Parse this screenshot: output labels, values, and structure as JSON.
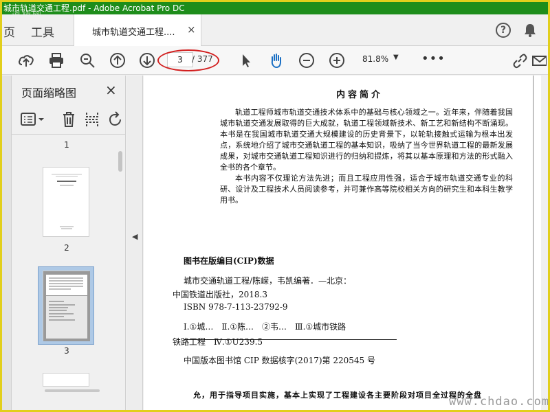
{
  "window": {
    "title": "城市轨道交通工程.pdf - Adobe Acrobat Pro DC",
    "watermark_top": "道桥网"
  },
  "menu": {
    "page": "页",
    "tools": "工具"
  },
  "tab": {
    "label": "城市轨道交通工程....",
    "close": "×"
  },
  "toolbar": {
    "current_page": "3",
    "total_pages": "/ 377",
    "zoom": "81.8%",
    "more": "•••"
  },
  "sidebar": {
    "title": "页面缩略图",
    "close": "×",
    "page_labels": [
      "1",
      "2",
      "3"
    ]
  },
  "document": {
    "intro_title": "内容简介",
    "intro_paragraphs": [
      "轨道工程师城市轨道交通技术体系中的基础与核心领域之一。近年来，伴随着我国城市轨道交通发展取得的巨大成就，轨道工程领域新技术、新工艺和新结构不断涌现。本书是在我国城市轨道交通大规模建设的历史背景下，以轮轨接触式运输为根本出发点，系统地介绍了城市交通轨道工程的基本知识，吸纳了当今世界轨道工程的最新发展成果，对城市交通轨道工程知识进行的归纳和提炼，将其以基本原理和方法的形式融入全书的各个章节。",
      "本书内容不仅理论方法先进；而且工程应用性强，适合于城市轨道交通专业的科研、设计及工程技术人员阅读参考，并可兼作高等院校相关方向的研究生和本科生教学用书。"
    ],
    "cip_title": "图书在版编目(CIP)数据",
    "cip_lines": [
      "城市交通轨道工程/陈嵘，韦凯编著．—北京：",
      "中国铁道出版社，2018.3",
      "ISBN 978-7-113-23792-9",
      "Ⅰ.①城…　Ⅱ.①陈…　②韦…　Ⅲ.①城市铁路",
      "铁路工程　Ⅳ.①U239.5",
      "中国版本图书馆 CIP 数据核字(2017)第 220545 号"
    ],
    "bottom_text": "允，用于指导项目实施，基本上实现了工程建设各主要阶段对项目全过程的全盘"
  },
  "watermark_bottom": "www.chdao.com",
  "colors": {
    "titlebar": "#1e8d1b",
    "frame": "#e2cf1c",
    "annotation_oval": "#d21f1f",
    "thumb_selected": "#aec9e6"
  }
}
